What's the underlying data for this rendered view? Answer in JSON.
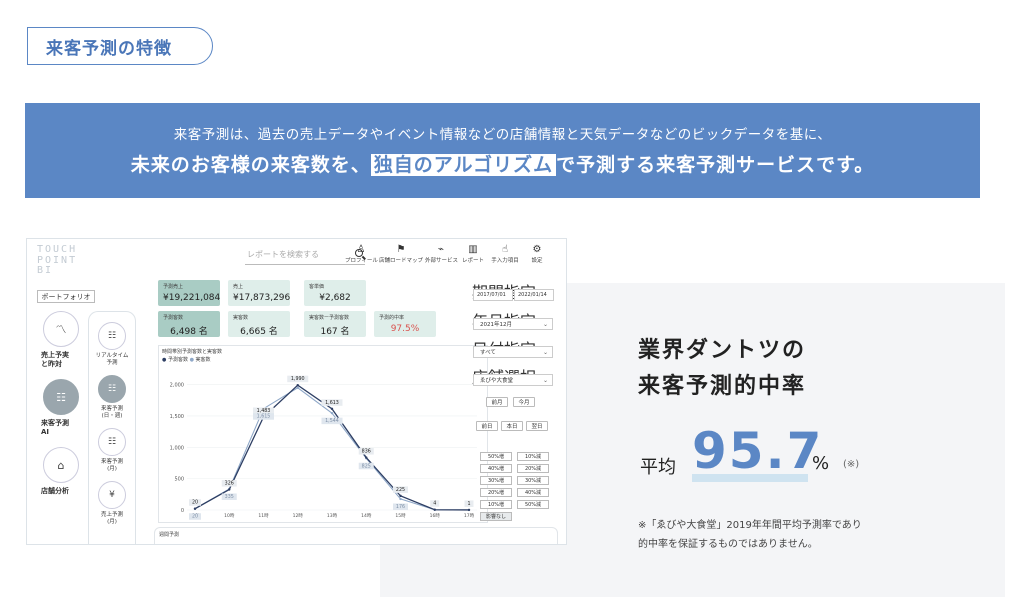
{
  "section_title": "来客予測の特徴",
  "banner": {
    "line1": "来客予測は、過去の売上データやイベント情報などの店舗情報と天気データなどのビックデータを基に、",
    "line2_pre": "未来のお客様の来客数を、",
    "line2_highlight": "独自のアルゴリズム",
    "line2_post": "で予測する来客予測サービスです。"
  },
  "app": {
    "logo": [
      "TOUCH",
      "POINT",
      "BI"
    ],
    "search_placeholder": "レポートを検索する",
    "topnav": [
      {
        "icon": "person-icon",
        "glyph": "♙",
        "label": "プロフィール"
      },
      {
        "icon": "flag-icon",
        "glyph": "⚑",
        "label": "店舗ロードマップ"
      },
      {
        "icon": "external-icon",
        "glyph": "⌁",
        "label": "外部サービス"
      },
      {
        "icon": "bar-chart-icon",
        "glyph": "▥",
        "label": "レポート"
      },
      {
        "icon": "hand-icon",
        "glyph": "☝",
        "label": "手入力項目"
      },
      {
        "icon": "gear-icon",
        "glyph": "⚙",
        "label": "設定"
      }
    ],
    "portfolio_label": "ポートフォリオ",
    "sidebar1": [
      {
        "label": "売上予実\nと昨対",
        "icon": "chart-icon",
        "glyph": "〽",
        "active": false
      },
      {
        "label": "来客予測\nAI",
        "icon": "people-icon",
        "glyph": "☷",
        "active": true
      },
      {
        "label": "店舗分析",
        "icon": "store-icon",
        "glyph": "⌂",
        "active": false
      }
    ],
    "sidebar2": [
      {
        "label": "リアルタイム\n予測",
        "icon": "people-icon",
        "glyph": "☷",
        "active": false
      },
      {
        "label": "来客予測\n(日・週)",
        "icon": "people-icon",
        "glyph": "☷",
        "active": true
      },
      {
        "label": "来客予測\n(月)",
        "icon": "people-icon",
        "glyph": "☷",
        "active": false
      },
      {
        "label": "売上予測\n(月)",
        "icon": "yen-icon",
        "glyph": "¥",
        "active": false
      }
    ],
    "kpis": [
      {
        "label": "予測売上",
        "value": "¥19,221,084",
        "dark": true
      },
      {
        "label": "売上",
        "value": "¥17,873,296",
        "dark": false
      },
      {
        "label": "客単価",
        "value": "¥2,682",
        "dark": false
      },
      {
        "label": "予測客数",
        "value": "6,498 名",
        "dark": true
      },
      {
        "label": "実客数",
        "value": "6,665 名",
        "dark": false
      },
      {
        "label": "実客数ー予測客数",
        "value": "167 名",
        "dark": false
      },
      {
        "label": "予測的中率",
        "value": "97.5%",
        "dark": false,
        "red": true
      }
    ],
    "chart_title": "時間帯別予測客数と実客数",
    "bottom_title": "週間予測",
    "right_panel": {
      "period_label": "期間指定",
      "date_from": "2017/07/01",
      "date_to": "2022/01/14",
      "month_label": "年月指定",
      "month_value": "2021年12月",
      "day_label": "日付指定",
      "day_value": "すべて",
      "store_label": "店舗選択",
      "store_value": "ゑびや大食堂",
      "month_buttons": [
        "前月",
        "今月"
      ],
      "day_buttons": [
        "前日",
        "本日",
        "翌日"
      ],
      "pct_buttons": [
        [
          "50%増",
          "10%減"
        ],
        [
          "40%増",
          "20%減"
        ],
        [
          "30%増",
          "30%減"
        ],
        [
          "20%増",
          "40%減"
        ],
        [
          "10%増",
          "50%減"
        ]
      ],
      "no_change": "影響なし"
    }
  },
  "chart_data": {
    "type": "line",
    "title": "時間帯別予測客数と実客数",
    "categories": [
      "09時",
      "10時",
      "11時",
      "12時",
      "13時",
      "14時",
      "15時",
      "16時",
      "17時"
    ],
    "series": [
      {
        "name": "予測客数",
        "color": "#2d3e63",
        "values": [
          20,
          326,
          1483,
          1990,
          1613,
          836,
          225,
          4,
          1
        ]
      },
      {
        "name": "実客数",
        "color": "#8fa8c8",
        "values": [
          20,
          335,
          1615,
          1948,
          1544,
          825,
          176,
          4,
          1
        ]
      }
    ],
    "ylim": [
      0,
      2200
    ],
    "yticks": [
      0,
      500,
      1000,
      1500,
      2000
    ],
    "ytick_labels": [
      "0",
      "500",
      "1,000",
      "1,500",
      "2,000"
    ],
    "series1_labels": [
      "20",
      "326",
      "1,483",
      "1,990",
      "1,613",
      "836",
      "225",
      "4",
      "1"
    ],
    "series2_labels": [
      "20",
      "335",
      "1,615",
      "",
      "1,544",
      "825",
      "176",
      "",
      ""
    ],
    "grid": true,
    "legend": "top-left"
  },
  "right": {
    "heading1": "業界ダントツの",
    "heading2": "来客予測的中率",
    "avg_prefix": "平均",
    "avg_value": "95.7",
    "avg_unit": "%",
    "avg_note": "(※)",
    "footnote1": "※「ゑびや大食堂」2019年年間平均予測率であり",
    "footnote2": "的中率を保証するものではありません。"
  }
}
